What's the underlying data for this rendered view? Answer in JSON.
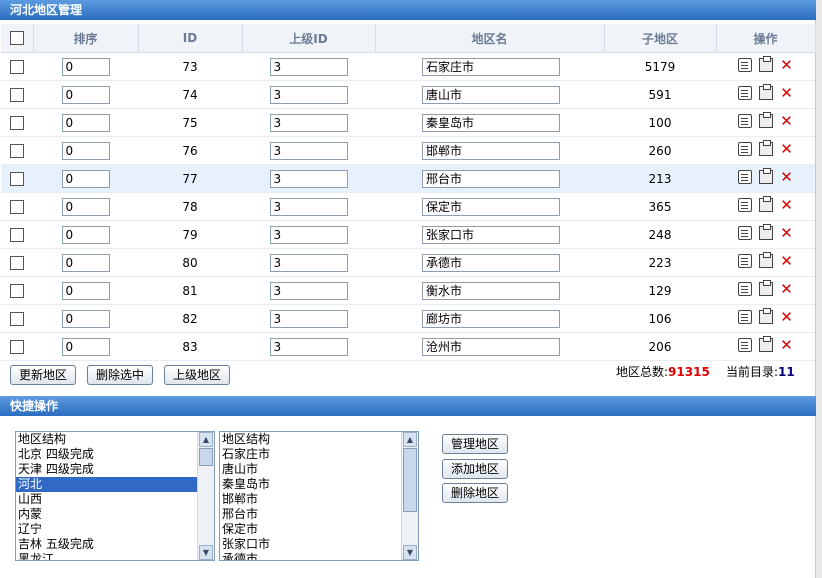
{
  "header": {
    "title": "河北地区管理"
  },
  "columns": {
    "check": "",
    "order": "排序",
    "id": "ID",
    "parent_id": "上级ID",
    "name": "地区名",
    "children": "子地区",
    "actions": "操作"
  },
  "rows": [
    {
      "order": "0",
      "id": "73",
      "parent": "3",
      "name": "石家庄市",
      "children": "5179"
    },
    {
      "order": "0",
      "id": "74",
      "parent": "3",
      "name": "唐山市",
      "children": "591"
    },
    {
      "order": "0",
      "id": "75",
      "parent": "3",
      "name": "秦皇岛市",
      "children": "100"
    },
    {
      "order": "0",
      "id": "76",
      "parent": "3",
      "name": "邯郸市",
      "children": "260"
    },
    {
      "order": "0",
      "id": "77",
      "parent": "3",
      "name": "邢台市",
      "children": "213"
    },
    {
      "order": "0",
      "id": "78",
      "parent": "3",
      "name": "保定市",
      "children": "365"
    },
    {
      "order": "0",
      "id": "79",
      "parent": "3",
      "name": "张家口市",
      "children": "248"
    },
    {
      "order": "0",
      "id": "80",
      "parent": "3",
      "name": "承德市",
      "children": "223"
    },
    {
      "order": "0",
      "id": "81",
      "parent": "3",
      "name": "衡水市",
      "children": "129"
    },
    {
      "order": "0",
      "id": "82",
      "parent": "3",
      "name": "廊坊市",
      "children": "106"
    },
    {
      "order": "0",
      "id": "83",
      "parent": "3",
      "name": "沧州市",
      "children": "206"
    }
  ],
  "buttons": {
    "update": "更新地区",
    "delete_selected": "删除选中",
    "parent_region": "上级地区"
  },
  "stats": {
    "total_label": "地区总数:",
    "total_value": "91315",
    "current_label": "当前目录:",
    "current_value": "11"
  },
  "quick": {
    "title": "快捷操作",
    "list1": [
      "地区结构",
      "北京 四级完成",
      "天津 四级完成",
      "河北",
      "山西",
      "内蒙",
      "辽宁",
      "吉林 五级完成",
      "黑龙江"
    ],
    "list1_selected": "河北",
    "list2": [
      "地区结构",
      "石家庄市",
      "唐山市",
      "秦皇岛市",
      "邯郸市",
      "邢台市",
      "保定市",
      "张家口市",
      "承德市"
    ],
    "manage": "管理地区",
    "add": "添加地区",
    "delete": "删除地区"
  }
}
